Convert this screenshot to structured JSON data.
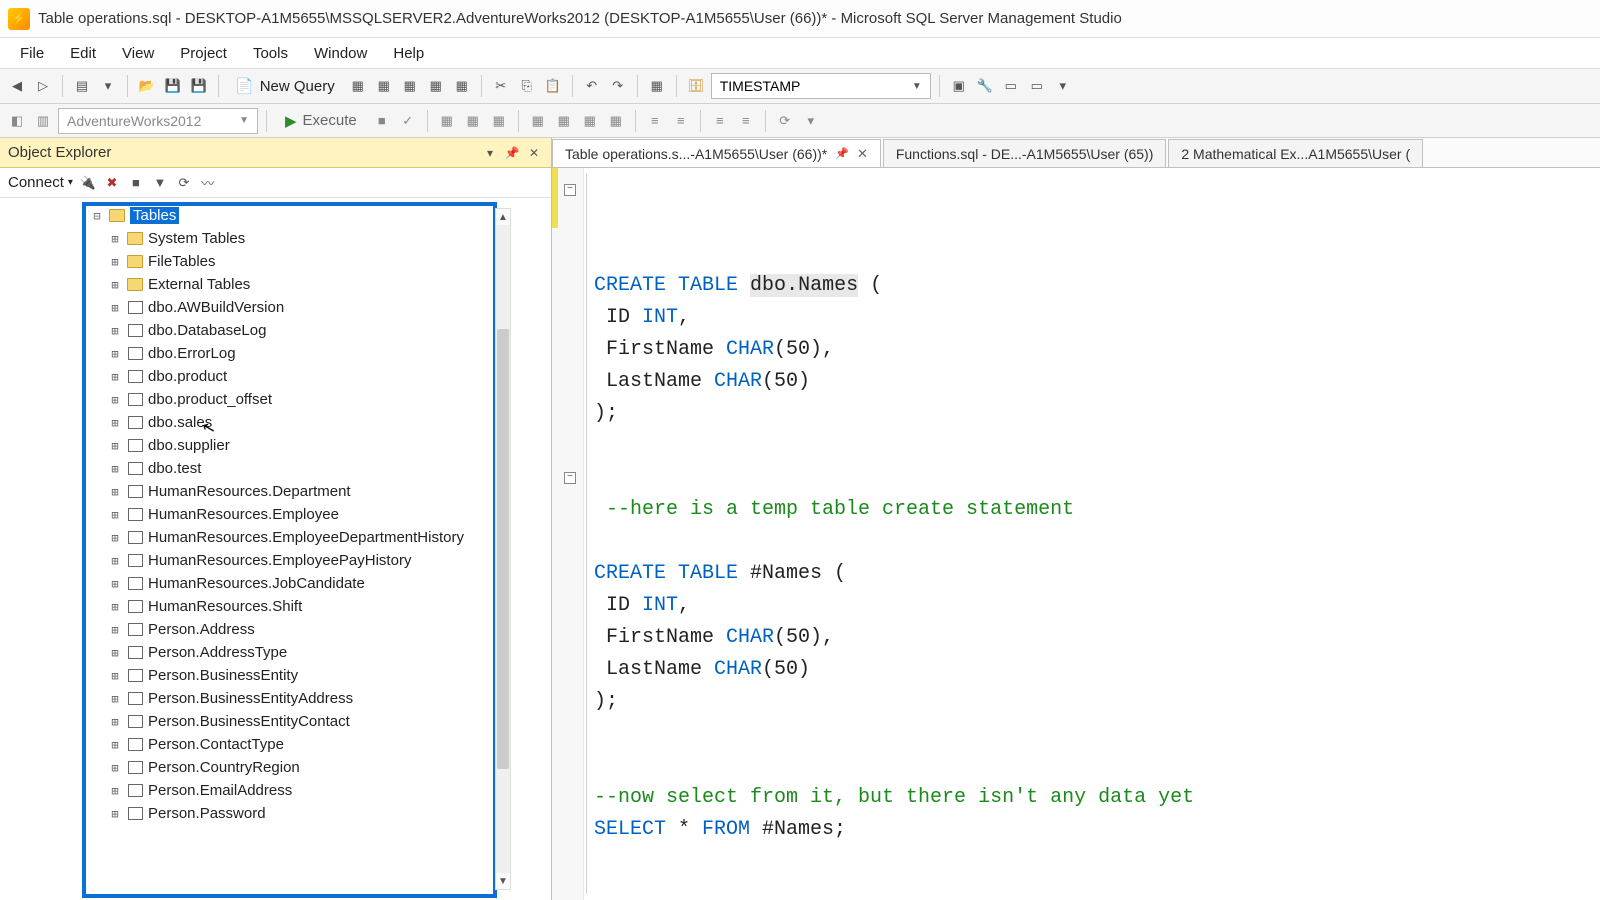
{
  "title": "Table operations.sql - DESKTOP-A1M5655\\MSSQLSERVER2.AdventureWorks2012 (DESKTOP-A1M5655\\User (66))* - Microsoft SQL Server Management Studio",
  "menu": {
    "items": [
      "File",
      "Edit",
      "View",
      "Project",
      "Tools",
      "Window",
      "Help"
    ]
  },
  "toolbar": {
    "new_query": "New Query",
    "timestamp": "TIMESTAMP"
  },
  "toolbar2": {
    "db": "AdventureWorks2012",
    "execute": "Execute"
  },
  "panel": {
    "title": "Object Explorer",
    "connect": "Connect"
  },
  "tree": {
    "root": "Tables",
    "folders": [
      "System Tables",
      "FileTables",
      "External Tables"
    ],
    "tables": [
      "dbo.AWBuildVersion",
      "dbo.DatabaseLog",
      "dbo.ErrorLog",
      "dbo.product",
      "dbo.product_offset",
      "dbo.sales",
      "dbo.supplier",
      "dbo.test",
      "HumanResources.Department",
      "HumanResources.Employee",
      "HumanResources.EmployeeDepartmentHistory",
      "HumanResources.EmployeePayHistory",
      "HumanResources.JobCandidate",
      "HumanResources.Shift",
      "Person.Address",
      "Person.AddressType",
      "Person.BusinessEntity",
      "Person.BusinessEntityAddress",
      "Person.BusinessEntityContact",
      "Person.ContactType",
      "Person.CountryRegion",
      "Person.EmailAddress",
      "Person.Password"
    ]
  },
  "tabs": [
    {
      "label": "Table operations.s...-A1M5655\\User (66))*",
      "active": true,
      "pinned": true
    },
    {
      "label": "Functions.sql - DE...-A1M5655\\User (65))",
      "active": false
    },
    {
      "label": "2 Mathematical Ex...A1M5655\\User (",
      "active": false
    }
  ],
  "code": {
    "lines": [
      [
        {
          "t": "CREATE TABLE",
          "c": "kw"
        },
        {
          "t": " "
        },
        {
          "t": "dbo",
          "c": "hl"
        },
        {
          "t": ".",
          "c": "hl"
        },
        {
          "t": "Names",
          "c": "hl"
        },
        {
          "t": " ("
        }
      ],
      [
        {
          "t": " ID "
        },
        {
          "t": "INT",
          "c": "ty"
        },
        {
          "t": ","
        }
      ],
      [
        {
          "t": " FirstName "
        },
        {
          "t": "CHAR",
          "c": "ty"
        },
        {
          "t": "(50),"
        }
      ],
      [
        {
          "t": " LastName "
        },
        {
          "t": "CHAR",
          "c": "ty"
        },
        {
          "t": "(50)"
        }
      ],
      [
        {
          "t": ");"
        }
      ],
      [],
      [],
      [
        {
          "t": " --here is a temp table create statement",
          "c": "cm"
        }
      ],
      [],
      [
        {
          "t": "CREATE TABLE",
          "c": "kw"
        },
        {
          "t": " #Names ("
        }
      ],
      [
        {
          "t": " ID "
        },
        {
          "t": "INT",
          "c": "ty"
        },
        {
          "t": ","
        }
      ],
      [
        {
          "t": " FirstName "
        },
        {
          "t": "CHAR",
          "c": "ty"
        },
        {
          "t": "(50),"
        }
      ],
      [
        {
          "t": " LastName "
        },
        {
          "t": "CHAR",
          "c": "ty"
        },
        {
          "t": "(50)"
        }
      ],
      [
        {
          "t": ");"
        }
      ],
      [],
      [],
      [
        {
          "t": "--now select from it, but there isn't any data yet",
          "c": "cm"
        }
      ],
      [
        {
          "t": "SELECT",
          "c": "kw"
        },
        {
          "t": " * "
        },
        {
          "t": "FROM",
          "c": "kw"
        },
        {
          "t": " #Names;"
        }
      ]
    ],
    "folds": [
      0,
      9
    ]
  }
}
